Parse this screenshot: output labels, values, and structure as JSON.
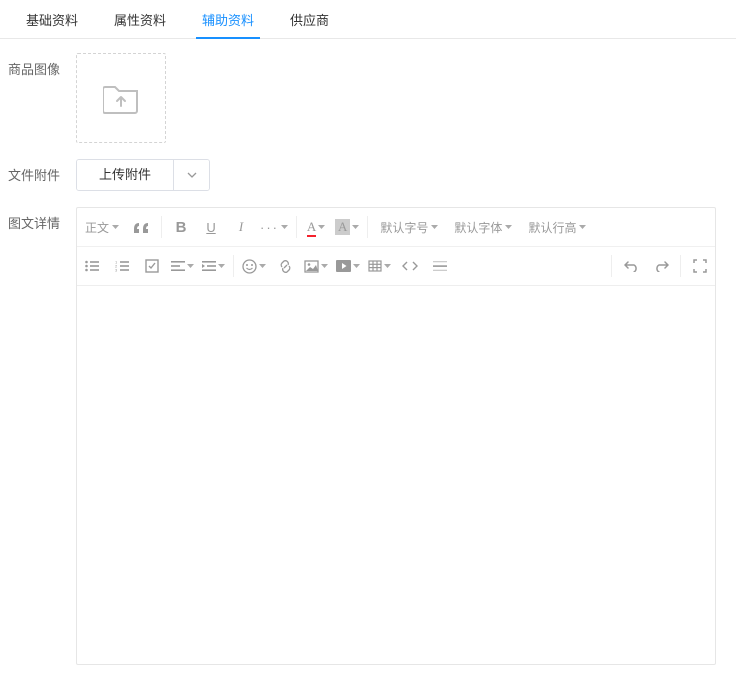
{
  "tabs": {
    "basic": "基础资料",
    "attr": "属性资料",
    "aux": "辅助资料",
    "supplier": "供应商"
  },
  "labels": {
    "image": "商品图像",
    "attachment": "文件附件",
    "detail": "图文详情"
  },
  "buttons": {
    "upload": "上传附件"
  },
  "toolbar": {
    "paragraph": "正文",
    "fontSize": "默认字号",
    "fontFamily": "默认字体",
    "lineHeight": "默认行高"
  }
}
